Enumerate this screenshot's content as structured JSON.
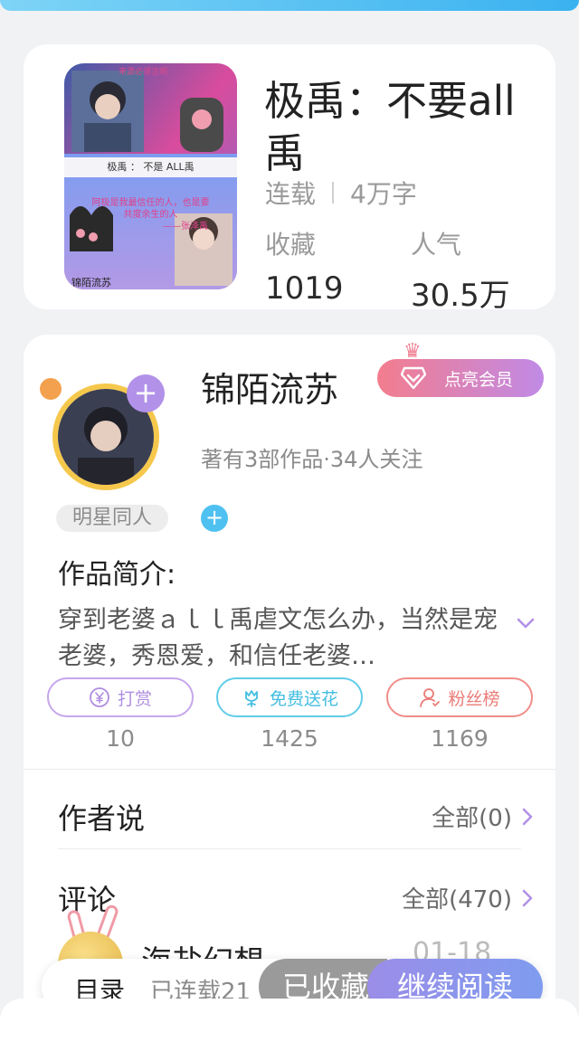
{
  "book": {
    "title": "极禹：不要all禹",
    "status": "连载",
    "word_count": "4万字",
    "favorites_label": "收藏",
    "favorites_value": "1019",
    "popularity_label": "人气",
    "popularity_value": "30.5万"
  },
  "cover": {
    "banner_text": "极禹 ： 不是 ALL禹",
    "quote_line1": "阿极是我最信任的人，也是要",
    "quote_line2": "共度余生的人",
    "quote_author": "——张泽禹",
    "footer_text": "锦陌流苏"
  },
  "author": {
    "name": "锦陌流苏",
    "meta": "著有3部作品·34人关注",
    "vip_label": "点亮会员"
  },
  "tag": {
    "label": "明星同人"
  },
  "intro": {
    "heading": "作品简介:",
    "text": "穿到老婆ａｌｌ禹虐文怎么办，当然是宠老婆，秀恩爱，和信任老婆…"
  },
  "actions": [
    {
      "label": "打赏",
      "count": "10",
      "icon": "yen-icon"
    },
    {
      "label": "免费送花",
      "count": "1425",
      "icon": "flower-icon"
    },
    {
      "label": "粉丝榜",
      "count": "1169",
      "icon": "user-icon"
    }
  ],
  "author_says": {
    "title": "作者说",
    "link": "全部(0)"
  },
  "comments": {
    "title": "评论",
    "link": "全部(470)",
    "first_name": "海盐幻想",
    "first_date": "01-18"
  },
  "bottom_bar": {
    "catalog": "目录",
    "serial": "已连载21",
    "collected": "已收藏",
    "continue": "继续阅读"
  },
  "colors": {
    "accent_purple": "#b291e8",
    "accent_blue": "#4fc1f0",
    "accent_red": "#ea7b77"
  }
}
